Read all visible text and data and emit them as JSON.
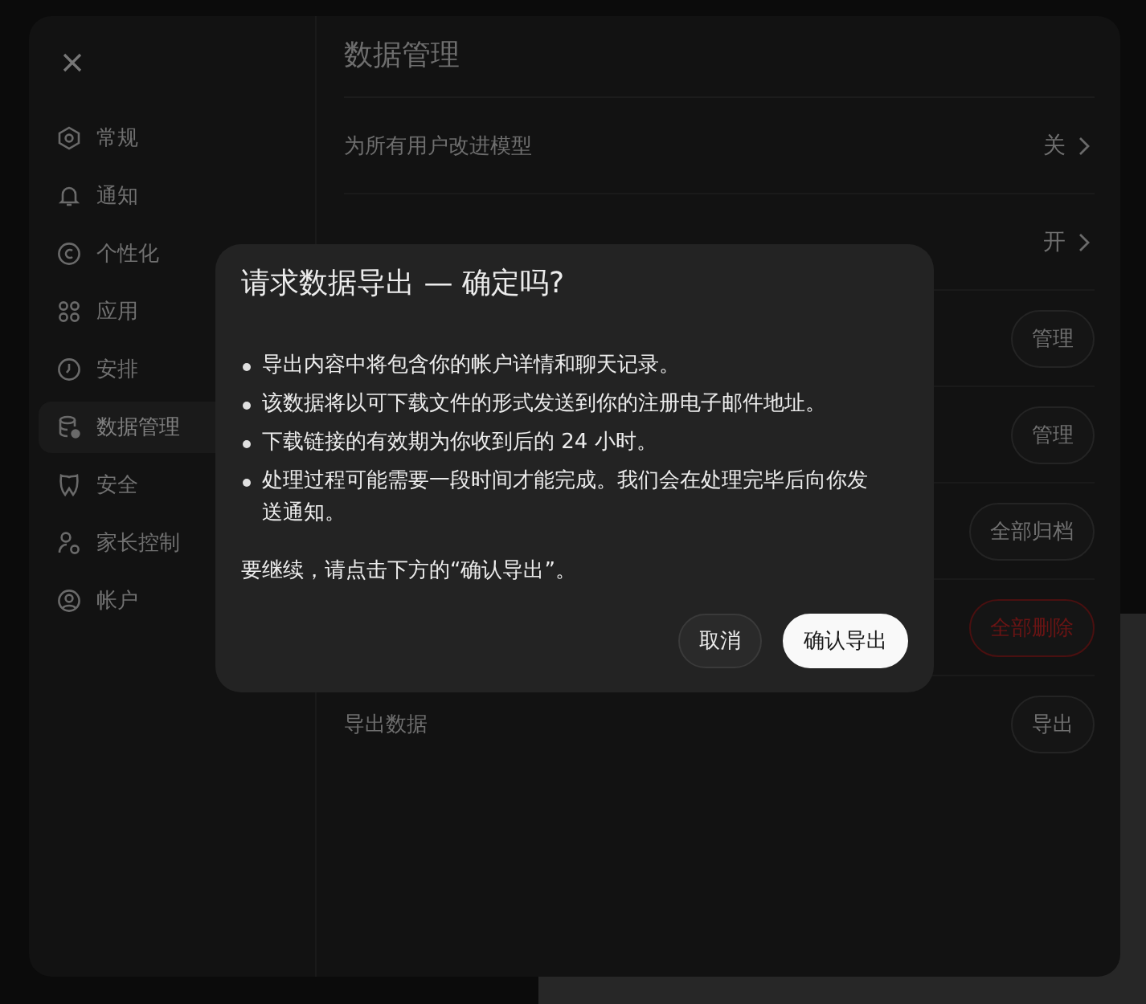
{
  "sidebar": {
    "items": [
      {
        "label": "常规",
        "selected": false
      },
      {
        "label": "通知",
        "selected": false
      },
      {
        "label": "个性化",
        "selected": false
      },
      {
        "label": "应用",
        "selected": false
      },
      {
        "label": "安排",
        "selected": false
      },
      {
        "label": "数据管理",
        "selected": true
      },
      {
        "label": "安全",
        "selected": false
      },
      {
        "label": "家长控制",
        "selected": false
      },
      {
        "label": "帐户",
        "selected": false
      }
    ]
  },
  "main": {
    "title": "数据管理",
    "rows": [
      {
        "kind": "value",
        "label": "为所有用户改进模型",
        "value": "关"
      },
      {
        "kind": "value",
        "value": "开"
      },
      {
        "kind": "button",
        "button": "管理",
        "danger": false
      },
      {
        "kind": "button",
        "button": "管理",
        "danger": false
      },
      {
        "kind": "button",
        "button": "全部归档",
        "danger": false
      },
      {
        "kind": "button",
        "button": "全部删除",
        "danger": true
      },
      {
        "kind": "button",
        "label": "导出数据",
        "button": "导出",
        "danger": false
      }
    ]
  },
  "dialog": {
    "title": "请求数据导出 — 确定吗?",
    "bullets": [
      "导出内容中将包含你的帐户详情和聊天记录。",
      "该数据将以可下载文件的形式发送到你的注册电子邮件地址。",
      "下载链接的有效期为你收到后的 24 小时。",
      "处理过程可能需要一段时间才能完成。我们会在处理完毕后向你发送通知。"
    ],
    "note": "要继续，请点击下方的“确认导出”。",
    "buttons": [
      {
        "label": "取消",
        "primary": false
      },
      {
        "label": "确认导出",
        "primary": true
      }
    ]
  }
}
